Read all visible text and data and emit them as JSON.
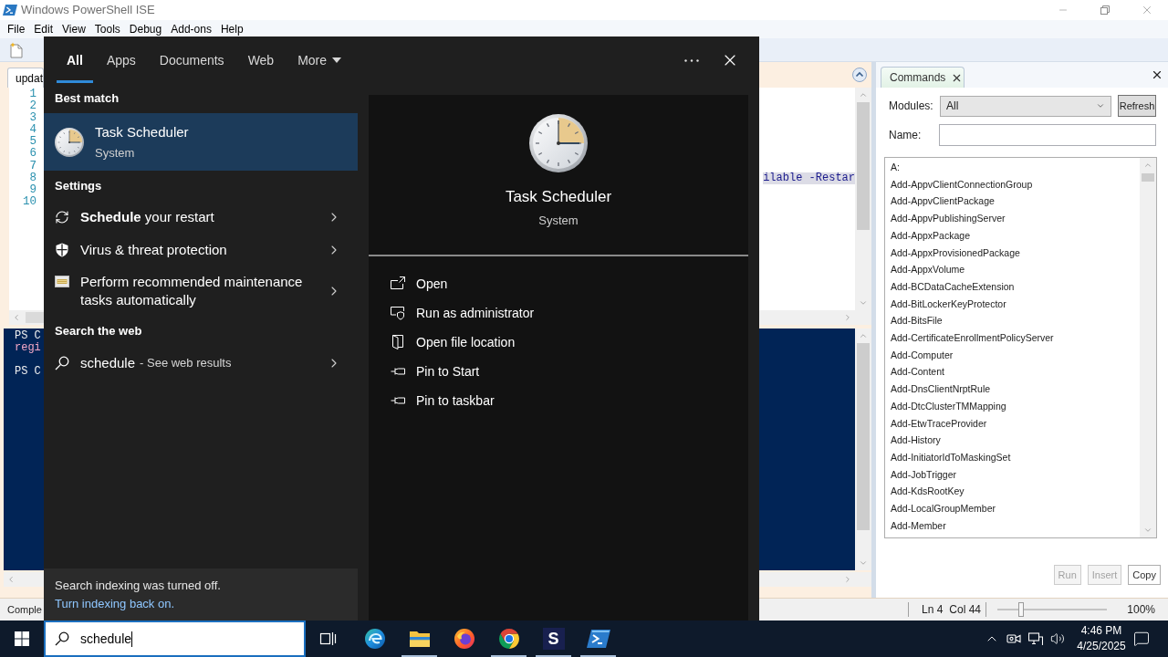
{
  "window": {
    "title": "Windows PowerShell ISE",
    "menu": [
      "File",
      "Edit",
      "View",
      "Tools",
      "Debug",
      "Add-ons",
      "Help"
    ]
  },
  "editor": {
    "tab": "updat",
    "lines": [
      {
        "number": "1"
      },
      {
        "number": "2"
      },
      {
        "number": "3"
      },
      {
        "number": "4"
      },
      {
        "number": "5"
      },
      {
        "number": "6"
      },
      {
        "number": "7"
      },
      {
        "number": "8",
        "code": "ilable -Restar",
        "highlighted": true
      },
      {
        "number": "9"
      },
      {
        "number": "10"
      }
    ]
  },
  "console": {
    "blocks": [
      {
        "lines": [
          {
            "text": "PS C",
            "kind": "prompt"
          },
          {
            "text": "regi",
            "kind": "output"
          }
        ]
      },
      {
        "lines": [
          {
            "text": "PS C",
            "kind": "prompt"
          }
        ]
      }
    ]
  },
  "status_bar": {
    "text": "Comple",
    "line": "Ln 4",
    "column": "Col 44",
    "zoom_slider": {
      "level": 0.22
    },
    "zoom": "100%"
  },
  "commands": {
    "tab": "Commands",
    "modules_label": "Modules:",
    "modules_value": "All",
    "refresh": "Refresh",
    "name_label": "Name:",
    "items": [
      "A:",
      "Add-AppvClientConnectionGroup",
      "Add-AppvClientPackage",
      "Add-AppvPublishingServer",
      "Add-AppxPackage",
      "Add-AppxProvisionedPackage",
      "Add-AppxVolume",
      "Add-BCDataCacheExtension",
      "Add-BitLockerKeyProtector",
      "Add-BitsFile",
      "Add-CertificateEnrollmentPolicyServer",
      "Add-Computer",
      "Add-Content",
      "Add-DnsClientNrptRule",
      "Add-DtcClusterTMMapping",
      "Add-EtwTraceProvider",
      "Add-History",
      "Add-InitiatorIdToMaskingSet",
      "Add-JobTrigger",
      "Add-KdsRootKey",
      "Add-LocalGroupMember",
      "Add-Member"
    ],
    "buttons": [
      {
        "label": "Run",
        "disabled": true
      },
      {
        "label": "Insert",
        "disabled": true
      },
      {
        "label": "Copy",
        "disabled": false
      }
    ]
  },
  "search_panel": {
    "tabs": [
      {
        "label": "All",
        "selected": true,
        "kind": "plain"
      },
      {
        "label": "Apps",
        "selected": false,
        "kind": "plain"
      },
      {
        "label": "Documents",
        "selected": false,
        "kind": "plain"
      },
      {
        "label": "Web",
        "selected": false,
        "kind": "plain"
      },
      {
        "label": "More",
        "selected": false,
        "kind": "dropdown"
      }
    ],
    "best_match": {
      "heading": "Best match",
      "title": "Task Scheduler",
      "subtitle": "System",
      "selected": true
    },
    "settings": {
      "heading": "Settings",
      "items": [
        {
          "text": "**Schedule** your restart",
          "kind": "restart"
        },
        {
          "text": "Virus & threat protection",
          "kind": "security"
        },
        {
          "text": "Perform recommended maintenance tasks automatically",
          "kind": "maintenance"
        }
      ]
    },
    "web": {
      "heading": "Search the web",
      "query": "schedule",
      "hint": "- See web results"
    },
    "notice": {
      "text": "Search indexing was turned off.",
      "link": "Turn indexing back on."
    },
    "preview": {
      "title": "Task Scheduler",
      "subtitle": "System",
      "actions": [
        {
          "label": "Open",
          "kind": "open"
        },
        {
          "label": "Run as administrator",
          "kind": "admin"
        },
        {
          "label": "Open file location",
          "kind": "location"
        },
        {
          "label": "Pin to Start",
          "kind": "pin"
        },
        {
          "label": "Pin to taskbar",
          "kind": "pin"
        }
      ]
    }
  },
  "taskbar": {
    "search_value": "schedule",
    "apps": [
      {
        "kind": "edge",
        "running": false
      },
      {
        "kind": "explorer",
        "running": true
      },
      {
        "kind": "firefox",
        "running": false
      },
      {
        "kind": "chrome",
        "running": true
      },
      {
        "kind": "lettered",
        "glyph": "S",
        "running": true
      },
      {
        "kind": "powershell",
        "running": true
      }
    ],
    "time": "4:46 PM",
    "date": "4/25/2025"
  }
}
